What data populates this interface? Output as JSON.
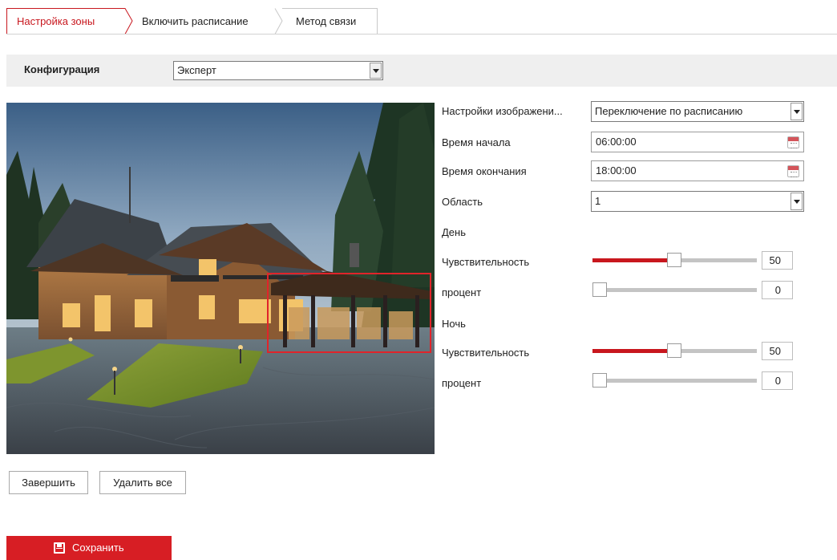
{
  "tabs": [
    {
      "label": "Настройка зоны",
      "active": true
    },
    {
      "label": "Включить расписание",
      "active": false
    },
    {
      "label": "Метод связи",
      "active": false
    }
  ],
  "config": {
    "label": "Конфигурация",
    "value": "Эксперт"
  },
  "settings": {
    "image_settings_label": "Настройки изображени...",
    "image_settings_value": "Переключение по расписанию",
    "start_time_label": "Время начала",
    "start_time_value": "06:00:00",
    "end_time_label": "Время окончания",
    "end_time_value": "18:00:00",
    "area_label": "Область",
    "area_value": "1",
    "day_label": "День",
    "night_label": "Ночь",
    "day": {
      "sensitivity_label": "Чувствительность",
      "sensitivity_value": "50",
      "percent_label": "процент",
      "percent_value": "0"
    },
    "night": {
      "sensitivity_label": "Чувствительность",
      "sensitivity_value": "50",
      "percent_label": "процент",
      "percent_value": "0"
    }
  },
  "buttons": {
    "finish": "Завершить",
    "delete_all": "Удалить все",
    "save": "Сохранить"
  },
  "colors": {
    "accent": "#c8171e",
    "save_button": "#d71e24",
    "roi_border": "#e0242a"
  },
  "icons": {
    "calendar": "calendar-icon",
    "save": "floppy-disk-icon",
    "dropdown": "chevron-down-icon"
  }
}
